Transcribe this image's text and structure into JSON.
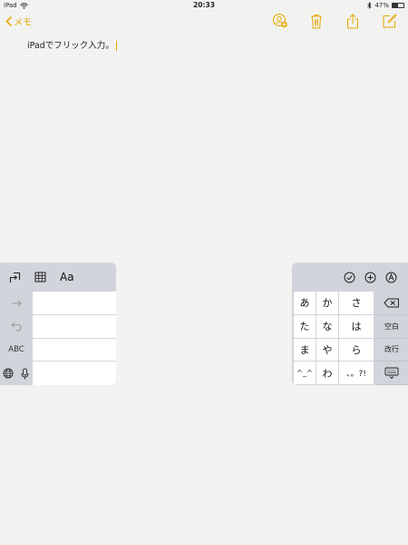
{
  "status_bar": {
    "device": "iPad",
    "time": "20:33",
    "battery": "47%",
    "battery_level": 0.47
  },
  "nav": {
    "back_label": "メモ",
    "icons": [
      "add-person-icon",
      "trash-icon",
      "share-icon",
      "compose-icon"
    ],
    "accent": "#e5a800"
  },
  "note": {
    "text": "iPadでフリック入力。"
  },
  "left_keyboard": {
    "toolbar": {
      "aa_label": "Aa"
    },
    "keys": {
      "abc_label": "ABC"
    }
  },
  "right_keyboard": {
    "kana": [
      "あ",
      "か",
      "さ",
      "た",
      "な",
      "は",
      "ま",
      "や",
      "ら",
      "^_^",
      "わ",
      "、。?!"
    ],
    "space_label": "空白",
    "return_label": "改行"
  }
}
